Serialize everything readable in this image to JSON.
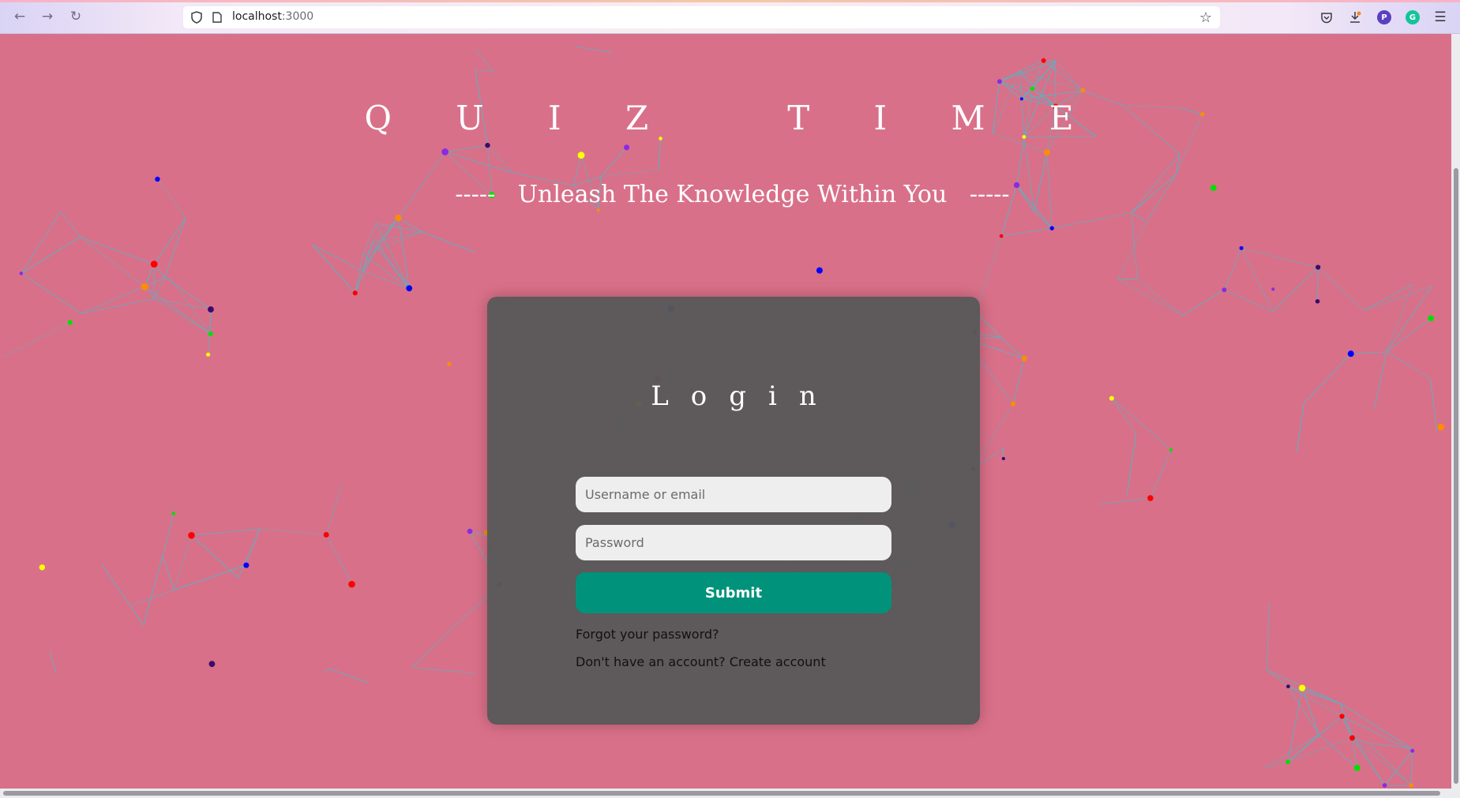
{
  "browser": {
    "url_host": "localhost",
    "url_port": ":3000",
    "profile_initial": "P"
  },
  "hero": {
    "title": "Q U I Z   T I M E",
    "tagline": "-----   Unleash The Knowledge Within You   -----"
  },
  "login": {
    "heading": "Login",
    "username_placeholder": "Username or email",
    "password_placeholder": "Password",
    "submit_label": "Submit",
    "forgot_label": "Forgot your password?",
    "signup_prefix": "Don't have an account?",
    "signup_link": "Create account"
  },
  "colors": {
    "background": "#d97089",
    "card": "#585858",
    "submit": "#00927a",
    "network_line": "#2ec9d6"
  },
  "icons": [
    "back-arrow-icon",
    "forward-arrow-icon",
    "reload-icon",
    "shield-icon",
    "page-icon",
    "bookmark-star-icon",
    "pocket-icon",
    "download-icon",
    "profile-avatar-icon",
    "grammarly-icon",
    "menu-icon"
  ]
}
